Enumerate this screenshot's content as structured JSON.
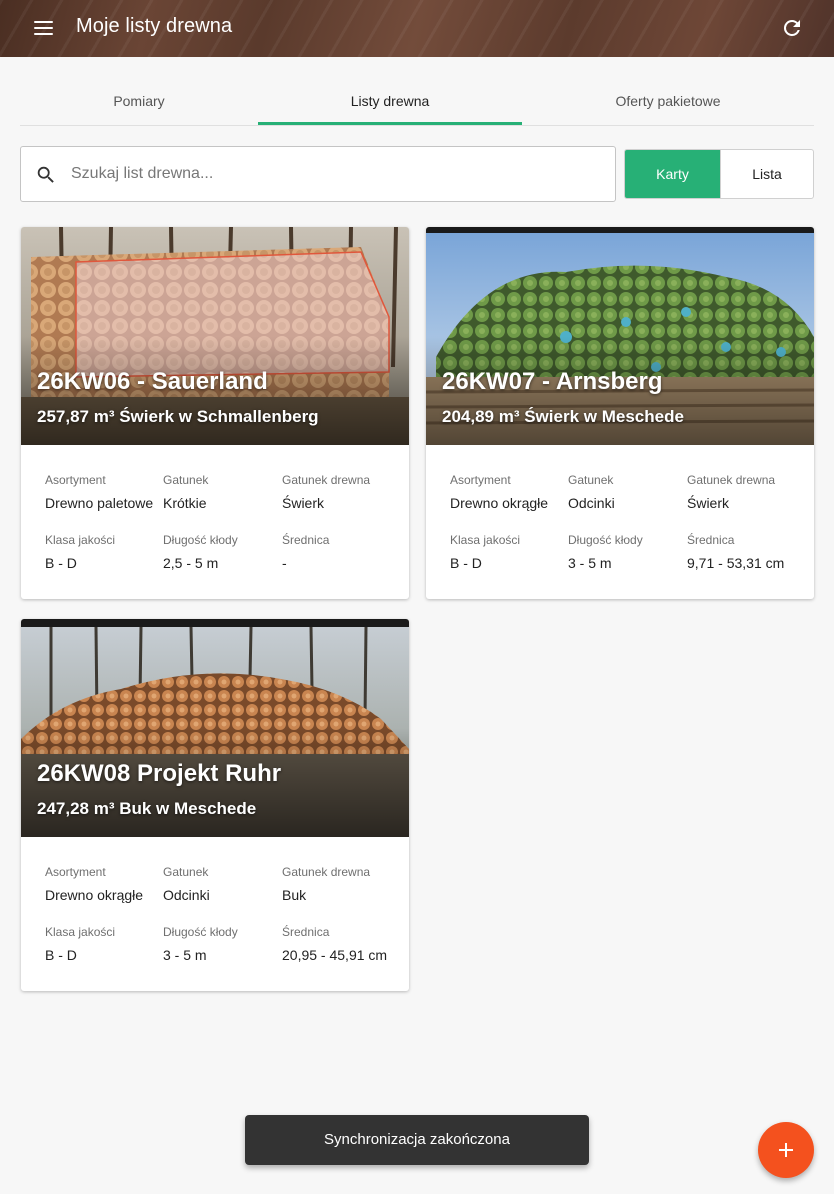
{
  "appbar": {
    "title": "Moje listy drewna"
  },
  "tabs": [
    {
      "label": "Pomiary"
    },
    {
      "label": "Listy drewna",
      "active": true
    },
    {
      "label": "Oferty pakietowe"
    }
  ],
  "search": {
    "placeholder": "Szukaj list drewna...",
    "value": ""
  },
  "view_toggle": {
    "cards": "Karty",
    "list": "Lista",
    "selected": "Karty"
  },
  "accent_color": "#27b076",
  "fab_color": "#f4511e",
  "labels": {
    "assortment": "Asortyment",
    "species": "Gatunek",
    "wood_species": "Gatunek drewna",
    "quality": "Klasa jakości",
    "length": "Długość kłody",
    "diameter": "Średnica"
  },
  "cards": [
    {
      "title": "26KW06 - Sauerland",
      "subtitle": "257,87 m³ Świerk w Schmallenberg",
      "assortment": "Drewno paletowe",
      "species": "Krótkie",
      "wood_species": "Świerk",
      "quality": "B - D",
      "length": "2,5 - 5 m",
      "diameter": "-"
    },
    {
      "title": "26KW07 - Arnsberg",
      "subtitle": "204,89 m³ Świerk w Meschede",
      "assortment": "Drewno okrągłe",
      "species": "Odcinki",
      "wood_species": "Świerk",
      "quality": "B - D",
      "length": "3 - 5 m",
      "diameter": "9,71 - 53,31 cm"
    },
    {
      "title": "26KW08 Projekt Ruhr",
      "subtitle": "247,28 m³ Buk w Meschede",
      "assortment": "Drewno okrągłe",
      "species": "Odcinki",
      "wood_species": "Buk",
      "quality": "B - D",
      "length": "3 - 5 m",
      "diameter": "20,95 - 45,91 cm"
    }
  ],
  "snackbar": {
    "message": "Synchronizacja zakończona"
  }
}
